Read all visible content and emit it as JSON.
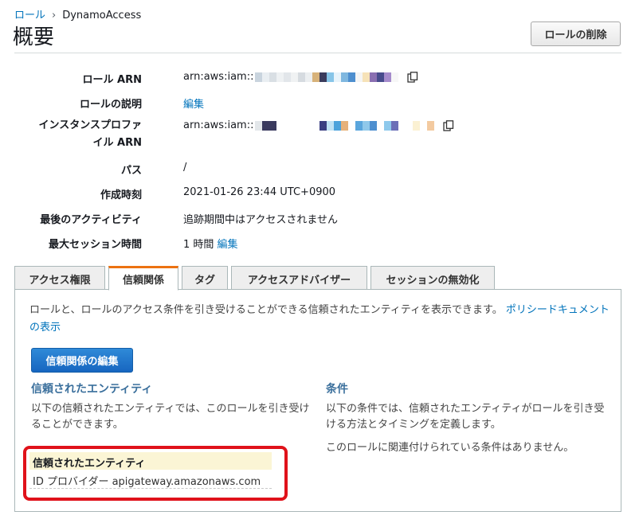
{
  "breadcrumb": {
    "parent": "ロール",
    "separator": "›",
    "current": "DynamoAccess"
  },
  "page_title": "概要",
  "delete_button": "ロールの削除",
  "summary": {
    "role_arn": {
      "label": "ロール ARN",
      "value_prefix": "arn:aws:iam::"
    },
    "role_description": {
      "label": "ロールの説明",
      "link": "編集"
    },
    "instance_profile_arn": {
      "label_line1": "インスタンスプロファ",
      "label_line2": "イル ARN",
      "value_prefix": "arn:aws:iam::"
    },
    "path": {
      "label": "パス",
      "value": "/"
    },
    "created": {
      "label": "作成時刻",
      "value": "2021-01-26 23:44 UTC+0900"
    },
    "last_activity": {
      "label": "最後のアクティビティ",
      "value": "追跡期間中はアクセスされません"
    },
    "max_session": {
      "label": "最大セッション時間",
      "value": "1 時間",
      "link": "編集"
    }
  },
  "tabs": [
    "アクセス権限",
    "信頼関係",
    "タグ",
    "アクセスアドバイザー",
    "セッションの無効化"
  ],
  "active_tab": "信頼関係",
  "trust": {
    "description": "ロールと、ロールのアクセス条件を引き受けることができる信頼されたエンティティを表示できます。",
    "policy_link": "ポリシードキュメントの表示",
    "edit_button": "信頼関係の編集",
    "entities_title": "信頼されたエンティティ",
    "entities_text": "以下の信頼されたエンティティでは、このロールを引き受けることができます。",
    "table_header": "信頼されたエンティティ",
    "table_row": "ID プロバイダー apigateway.amazonaws.com",
    "conditions_title": "条件",
    "conditions_text": "以下の条件では、信頼されたエンティティがロールを引き受ける方法とタイミングを定義します。",
    "conditions_none": "このロールに関連付けられている条件はありません。"
  },
  "colors": {
    "link": "#0073bb",
    "section_title": "#3a6f9c",
    "tab_accent": "#ec7211",
    "primary_button": "#1766c0",
    "highlight": "#e0121a"
  }
}
